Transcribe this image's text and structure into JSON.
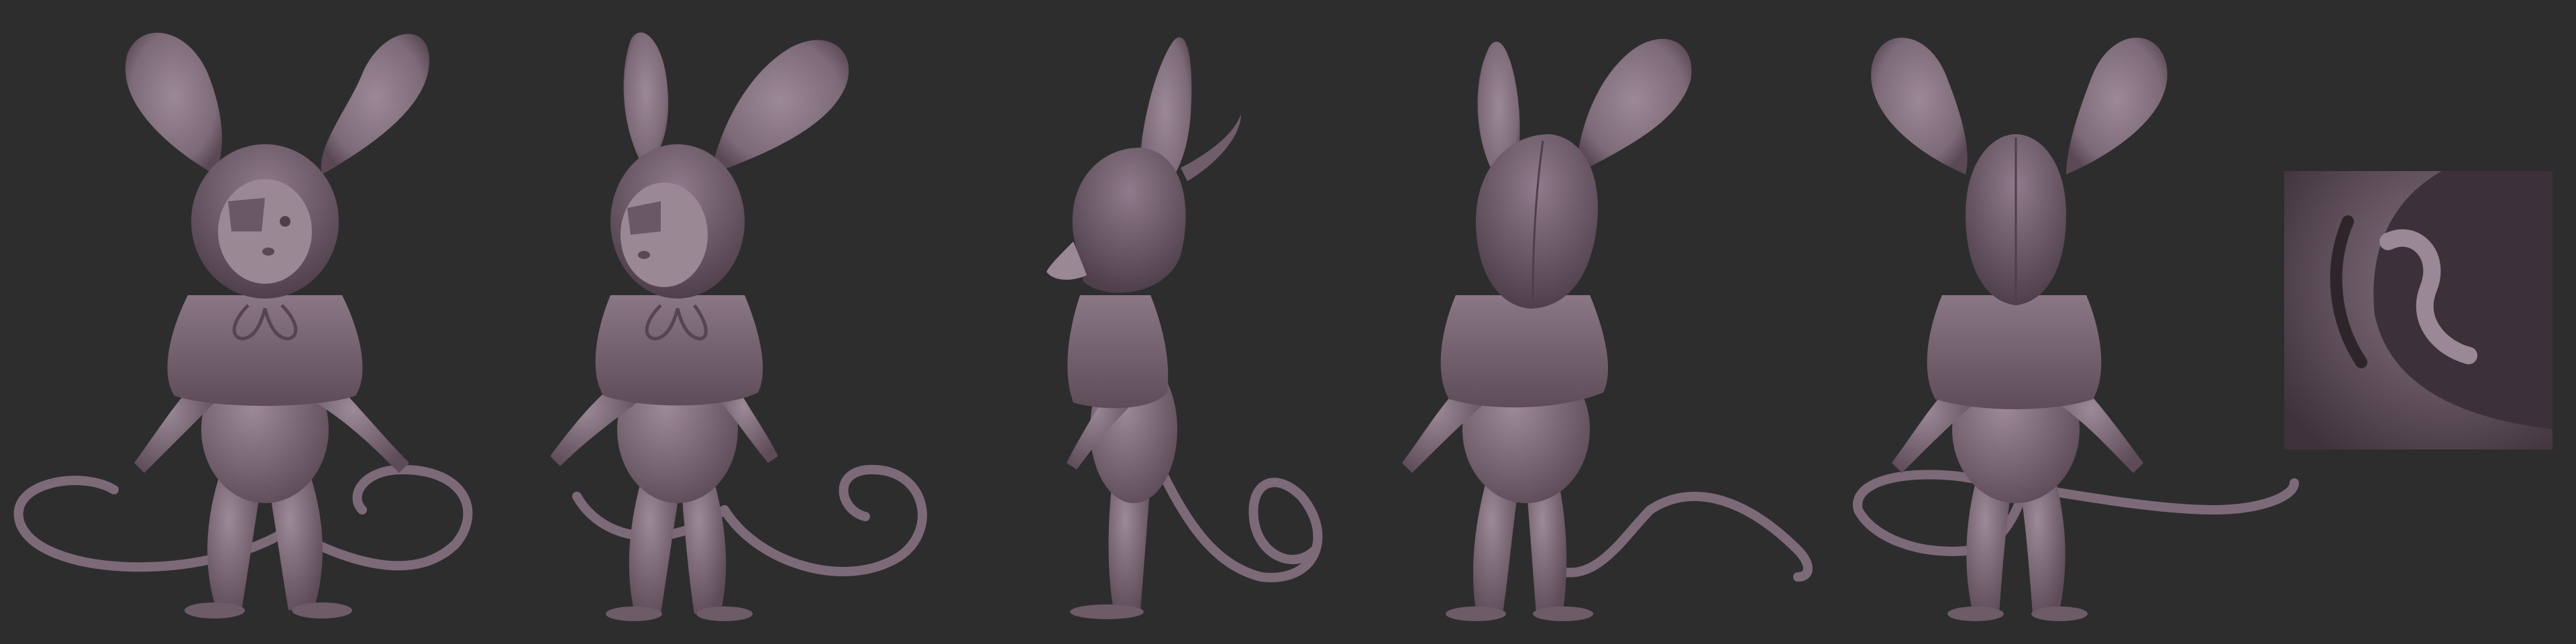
{
  "canvas": {
    "background": "#2d2d2d"
  },
  "palette": {
    "clay": "#7a6774",
    "clay_mid": "#8e7a88",
    "clay_light": "#a593a0",
    "clay_dark": "#4e3f4a",
    "clay_deep": "#3a2f37"
  },
  "views": [
    {
      "id": "front",
      "facing": "front"
    },
    {
      "id": "three-quarter-left",
      "facing": "front-three-quarter"
    },
    {
      "id": "side-left",
      "facing": "side"
    },
    {
      "id": "back-three-quarter",
      "facing": "back-three-quarter"
    },
    {
      "id": "back",
      "facing": "back"
    }
  ],
  "detail_inset": {
    "subject": "tail-tip-closeup"
  }
}
